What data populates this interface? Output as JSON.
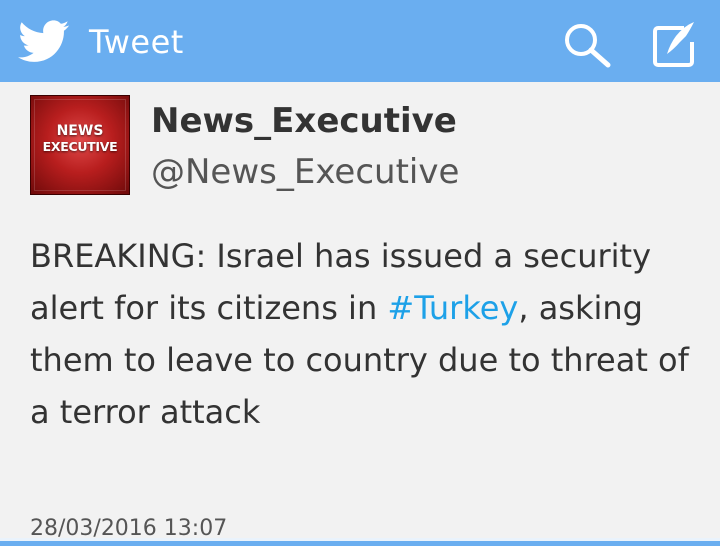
{
  "header": {
    "logo_icon": "twitter-bird-icon",
    "title": "Tweet",
    "search_icon": "search-icon",
    "compose_icon": "compose-icon",
    "background_color": "#6aaef0"
  },
  "tweet": {
    "avatar": {
      "logo_line1": "NEWS",
      "logo_line2": "EXECUTIVE"
    },
    "display_name": "News_Executive",
    "handle": "@News_Executive",
    "text_part1": "BREAKING: Israel has issued a security alert for its citizens in ",
    "hashtag": "#Turkey",
    "text_part2": ", asking them to leave to country due to threat of a terror attack",
    "timestamp": "28/03/2016 13:07",
    "hashtag_color": "#1da1e8"
  }
}
